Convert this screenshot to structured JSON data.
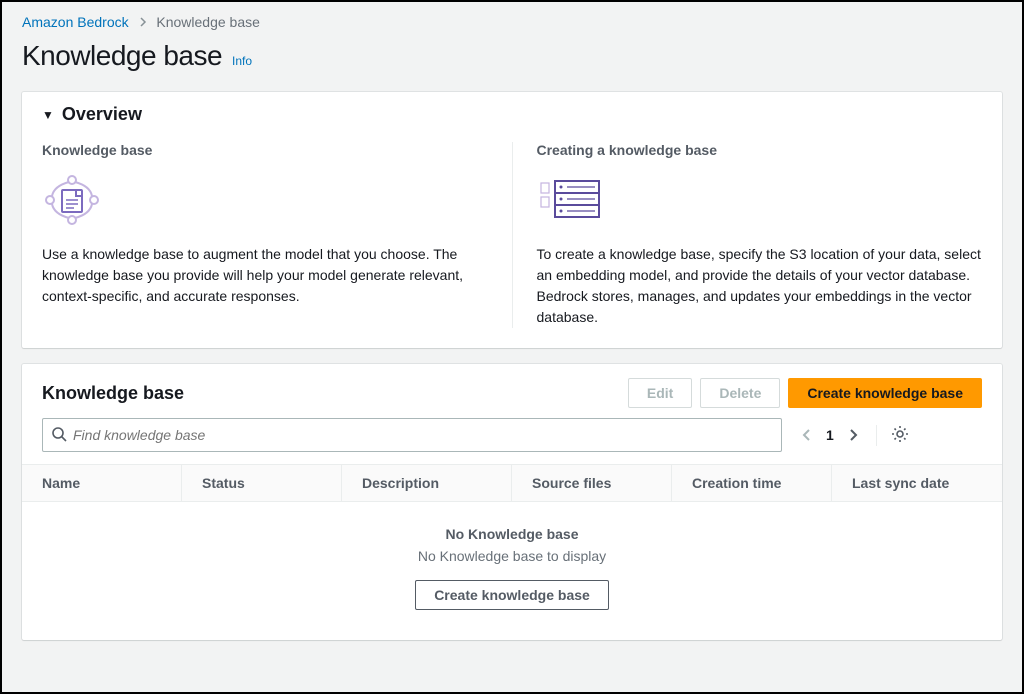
{
  "breadcrumb": {
    "root": "Amazon Bedrock",
    "current": "Knowledge base"
  },
  "page": {
    "title": "Knowledge base",
    "info": "Info"
  },
  "overview": {
    "title": "Overview",
    "left": {
      "heading": "Knowledge base",
      "text": "Use a knowledge base to augment the model that you choose. The knowledge base you provide will help your model generate relevant, context-specific, and accurate responses."
    },
    "right": {
      "heading": "Creating a knowledge base",
      "text": "To create a knowledge base, specify the S3 location of your data, select an embedding model, and provide the details of your vector database. Bedrock stores, manages, and updates your embeddings in the vector database."
    }
  },
  "kb_section": {
    "title": "Knowledge base",
    "edit": "Edit",
    "delete": "Delete",
    "create": "Create knowledge base",
    "search_placeholder": "Find knowledge base",
    "page_number": "1",
    "columns": {
      "name": "Name",
      "status": "Status",
      "description": "Description",
      "source": "Source files",
      "ctime": "Creation time",
      "sync": "Last sync date"
    },
    "empty": {
      "title": "No Knowledge base",
      "subtitle": "No Knowledge base to display",
      "button": "Create knowledge base"
    }
  }
}
